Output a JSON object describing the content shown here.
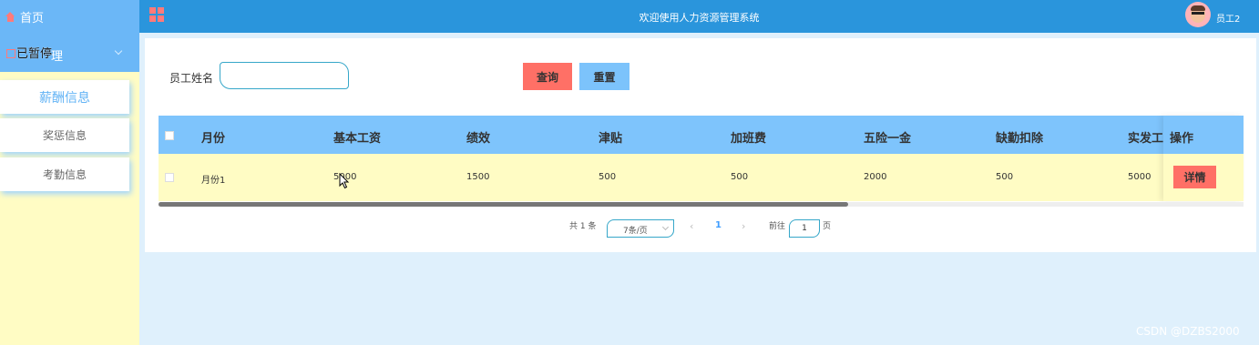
{
  "header": {
    "title": "欢迎使用人力资源管理系统",
    "username": "员工2"
  },
  "sidebar": {
    "home": "首页",
    "group_label": "理",
    "group_overlay": "已暂停",
    "items": [
      {
        "label": "薪酬信息",
        "active": true
      },
      {
        "label": "奖惩信息",
        "active": false
      },
      {
        "label": "考勤信息",
        "active": false
      }
    ]
  },
  "search": {
    "label": "员工姓名",
    "value": "",
    "placeholder": ""
  },
  "buttons": {
    "query": "查询",
    "reset": "重置"
  },
  "table": {
    "columns": [
      "月份",
      "基本工资",
      "绩效",
      "津贴",
      "加班费",
      "五险一金",
      "缺勤扣除",
      "实发工资",
      "操作"
    ],
    "rows": [
      {
        "month": "月份1",
        "base": "5000",
        "perf": "1500",
        "allowance": "500",
        "overtime": "500",
        "insurance": "2000",
        "absence": "500",
        "net": "5000",
        "action": "详情"
      }
    ]
  },
  "pagination": {
    "total": "共 1 条",
    "page_size": "7条/页",
    "current": "1",
    "goto_prefix": "前往",
    "goto_value": "1",
    "goto_suffix": "页",
    "prev": "‹",
    "next": "›"
  },
  "watermark": "CSDN @DZBS2000",
  "colors": {
    "header": "#2a95dc",
    "sidebar": "#fffcc4",
    "table_head": "#7ec4fc",
    "query": "#ff7066",
    "reset": "#7cc3fb"
  }
}
